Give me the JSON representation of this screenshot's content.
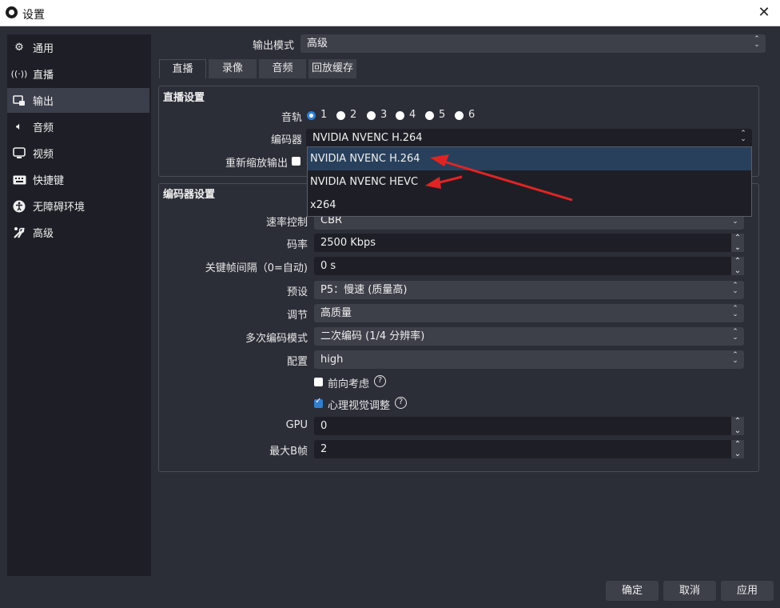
{
  "window": {
    "title": "设置",
    "close_icon": "close-icon"
  },
  "sidebar": {
    "items": [
      {
        "label": "通用",
        "icon": "gear-icon"
      },
      {
        "label": "直播",
        "icon": "broadcast-icon"
      },
      {
        "label": "输出",
        "icon": "output-icon"
      },
      {
        "label": "音频",
        "icon": "speaker-icon"
      },
      {
        "label": "视频",
        "icon": "monitor-icon"
      },
      {
        "label": "快捷键",
        "icon": "keyboard-icon"
      },
      {
        "label": "无障碍环境",
        "icon": "accessibility-icon"
      },
      {
        "label": "高级",
        "icon": "tools-icon"
      }
    ],
    "active": "输出"
  },
  "output_mode": {
    "label": "输出模式",
    "value": "高级"
  },
  "tabs": [
    {
      "label": "直播"
    },
    {
      "label": "录像"
    },
    {
      "label": "音频"
    },
    {
      "label": "回放缓存"
    }
  ],
  "active_tab": "直播",
  "stream_settings": {
    "title": "直播设置",
    "audio_track_label": "音轨",
    "tracks": [
      "1",
      "2",
      "3",
      "4",
      "5",
      "6"
    ],
    "selected_track": "1",
    "encoder_label": "编码器",
    "encoder_value": "NVIDIA NVENC H.264",
    "rescale_label": "重新缩放输出",
    "rescale_checked": false
  },
  "encoder_dropdown": {
    "options": [
      "NVIDIA NVENC H.264",
      "NVIDIA NVENC HEVC",
      "x264"
    ],
    "selected": "NVIDIA NVENC H.264"
  },
  "encoder_settings": {
    "title": "编码器设置",
    "rate_control": {
      "label": "速率控制",
      "value": "CBR"
    },
    "bitrate": {
      "label": "码率",
      "value": "2500 Kbps"
    },
    "keyframe": {
      "label": "关键帧间隔（0=自动)",
      "value": "0 s"
    },
    "preset": {
      "label": "预设",
      "value": "P5：慢速 (质量高)"
    },
    "tuning": {
      "label": "调节",
      "value": "高质量"
    },
    "multipass": {
      "label": "多次编码模式",
      "value": "二次编码 (1/4 分辨率)"
    },
    "profile": {
      "label": "配置",
      "value": "high"
    },
    "lookahead": {
      "label": "前向考虑",
      "checked": false
    },
    "psycho_visual": {
      "label": "心理视觉调整",
      "checked": true
    },
    "gpu": {
      "label": "GPU",
      "value": "0"
    },
    "max_bframes": {
      "label": "最大B帧",
      "value": "2"
    }
  },
  "buttons": {
    "ok": "确定",
    "cancel": "取消",
    "apply": "应用"
  },
  "colors": {
    "background": "#2b2d37",
    "sidebar": "#1e1f26",
    "control": "#3d3f49",
    "accent": "#2f7fd1",
    "annotation_arrow": "#e02424"
  }
}
